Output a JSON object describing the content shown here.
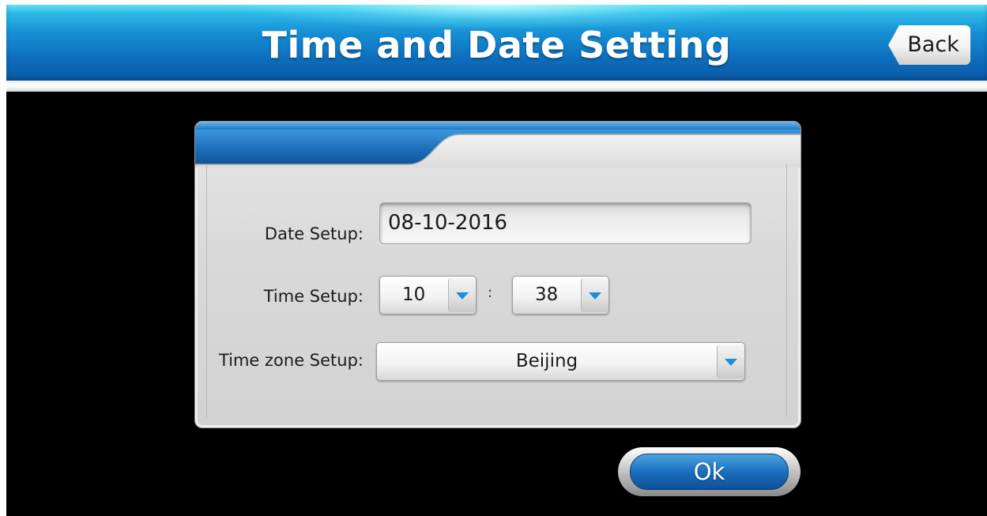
{
  "header": {
    "title": "Time and Date Setting",
    "back_label": "Back"
  },
  "form": {
    "date_label": "Date Setup:",
    "date_value": "08-10-2016",
    "time_label": "Time Setup:",
    "hour_value": "10",
    "time_separator": ":",
    "minute_value": "38",
    "timezone_label": "Time zone Setup:",
    "timezone_value": "Beijing"
  },
  "actions": {
    "ok_label": "Ok"
  },
  "colors": {
    "header_blue": "#0d6fbe",
    "accent_blue": "#1e8fd6",
    "panel_gray": "#d9d9d9",
    "background": "#000000"
  },
  "icons": {
    "dropdown": "chevron-down-icon",
    "back": "back-arrow-shape"
  }
}
